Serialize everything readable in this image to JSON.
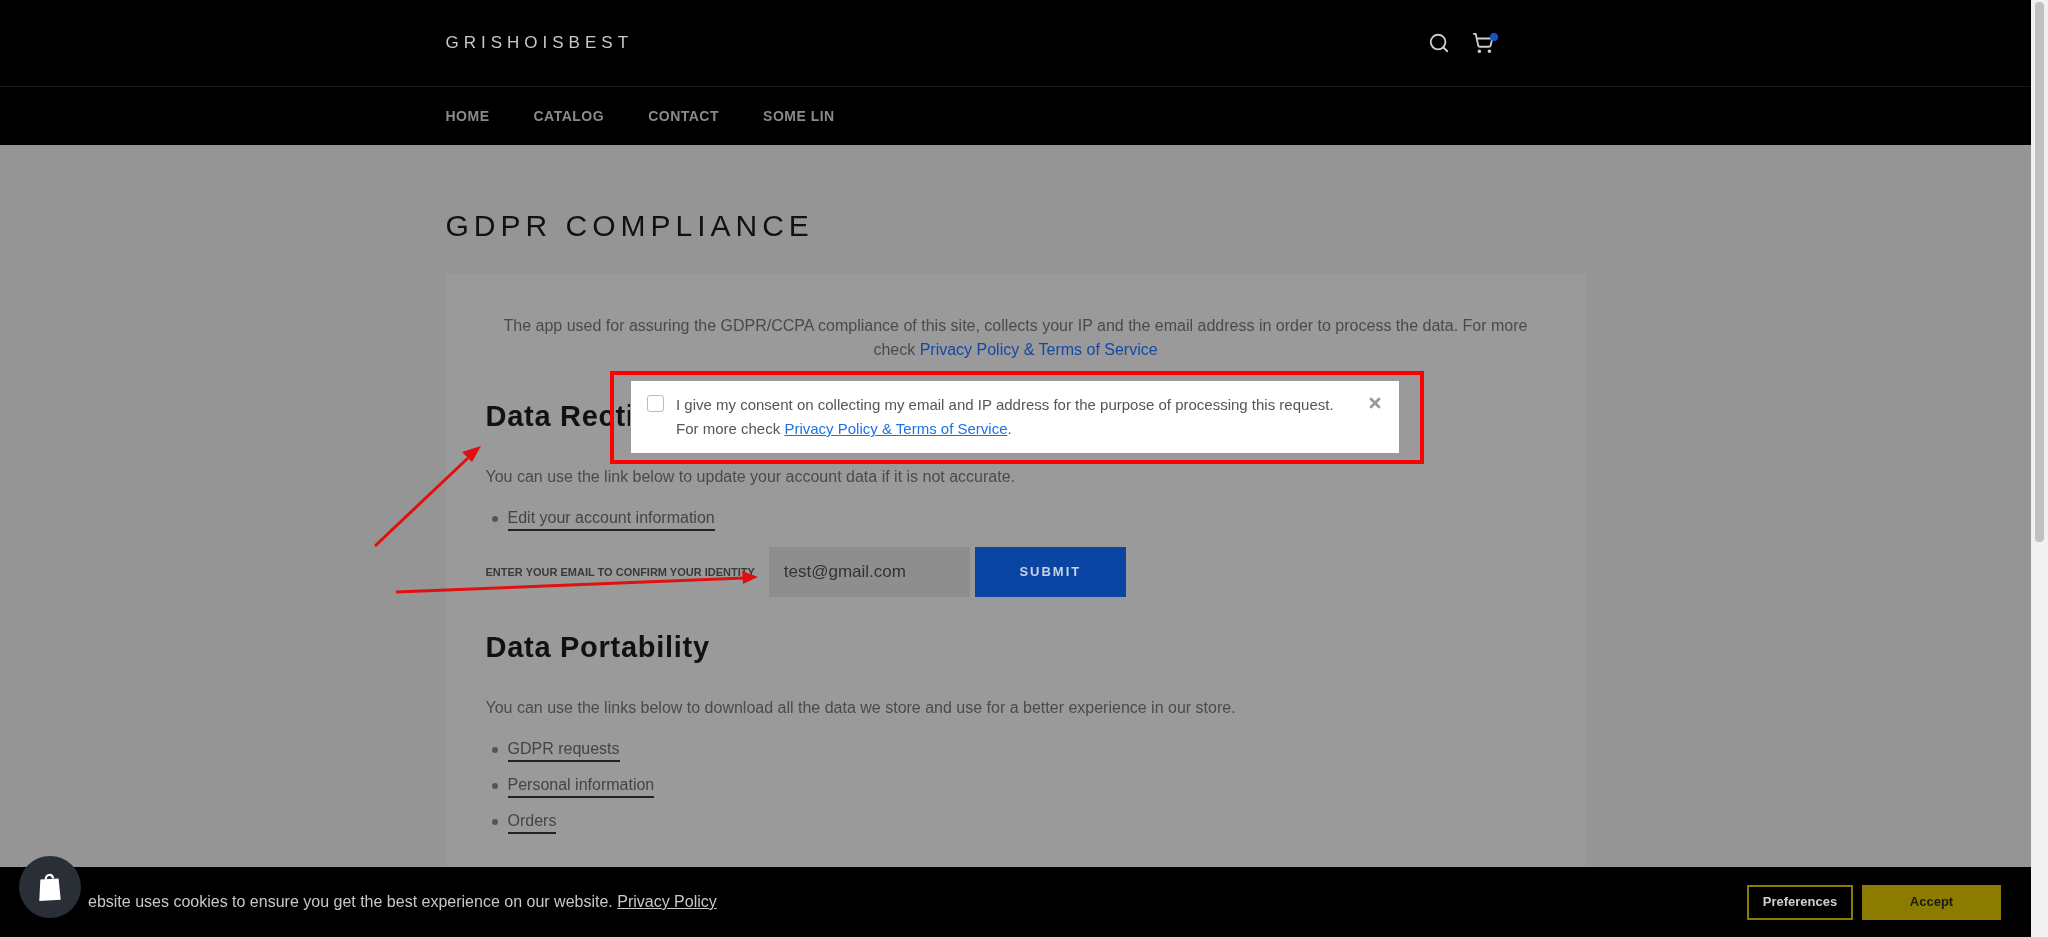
{
  "header": {
    "logo": "GRISHOISBEST"
  },
  "nav": [
    {
      "label": "HOME"
    },
    {
      "label": "CATALOG"
    },
    {
      "label": "CONTACT"
    },
    {
      "label": "SOME LIN"
    }
  ],
  "page_title": "GDPR COMPLIANCE",
  "intro": {
    "text": "The app used for assuring the GDPR/CCPA compliance of this site, collects your IP and the email address in order to process the data. For more check",
    "link": "Privacy Policy & Terms of Service"
  },
  "sections": [
    {
      "heading": "Data Recti",
      "text": "You can use the link below to update your account data if it is not accurate.",
      "links": [
        "Edit your account information"
      ],
      "email_form": {
        "label": "ENTER YOUR EMAIL TO CONFIRM YOUR IDENTITY",
        "value": "test@gmail.com",
        "button": "SUBMIT"
      }
    },
    {
      "heading": "Data Portability",
      "text": "You can use the links below to download all the data we store and use for a better experience in our store.",
      "links": [
        "GDPR requests",
        "Personal information",
        "Orders"
      ]
    }
  ],
  "consent_modal": {
    "checked": false,
    "text": "I give my consent on collecting my email and IP address for the purpose of processing this request. For more check",
    "link": "Privacy Policy & Terms of Service",
    "after": "."
  },
  "cookie_bar": {
    "text": "ebsite uses cookies to ensure you get the best experience on our website.",
    "link": "Privacy Policy",
    "buttons": [
      {
        "label": "Preferences",
        "kind": "outline"
      },
      {
        "label": "Accept",
        "kind": "filled"
      }
    ]
  }
}
